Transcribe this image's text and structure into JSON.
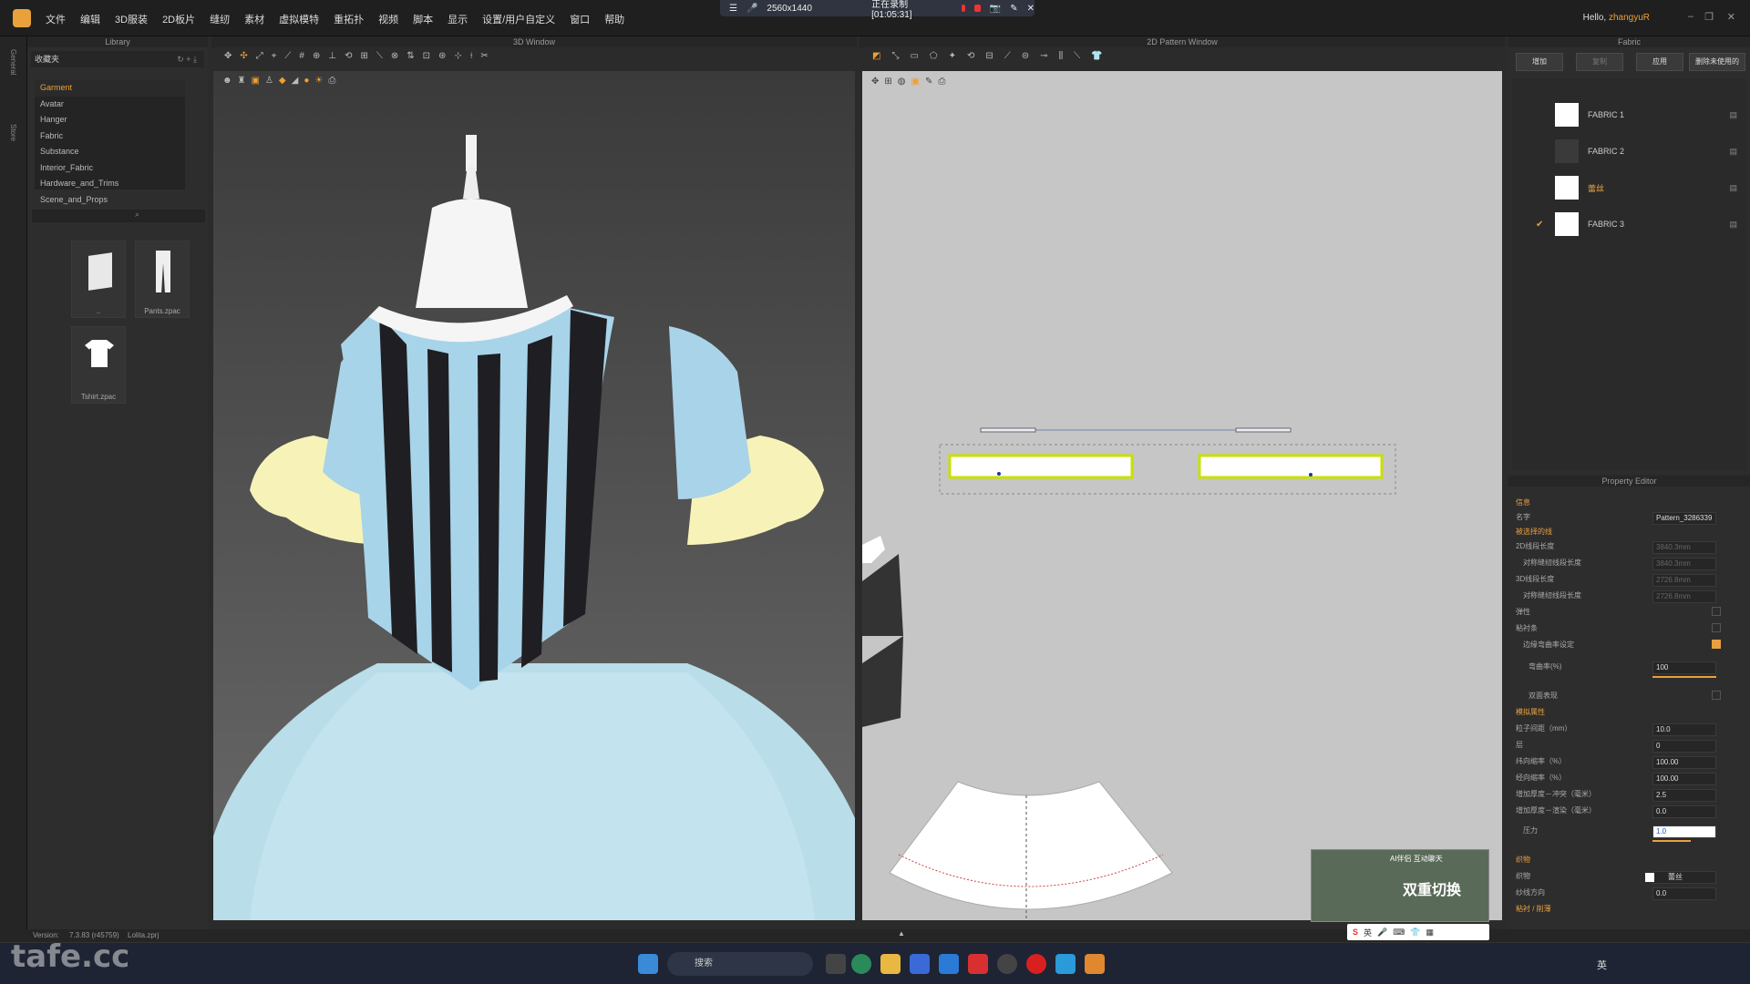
{
  "menubar": {
    "items": [
      "文件",
      "编辑",
      "3D服装",
      "2D板片",
      "缝纫",
      "素材",
      "虚拟模特",
      "重拓扑",
      "视频",
      "脚本",
      "显示",
      "设置/用户自定义",
      "窗口",
      "帮助"
    ],
    "greeting": "Hello,",
    "user": "zhangyuR"
  },
  "recording": {
    "resolution": "2560x1440",
    "status": "正在录制 [01:05:31]"
  },
  "leftstrip": {
    "tabs": [
      "General",
      "Store"
    ]
  },
  "library": {
    "title": "Library",
    "folder": "收藏夹",
    "tree": [
      "Garment",
      "Avatar",
      "Hanger",
      "Fabric",
      "Substance",
      "Interior_Fabric",
      "Hardware_and_Trims",
      "Scene_and_Props"
    ],
    "selected": 0,
    "thumbnails": [
      {
        "label": "..",
        "icon": "folder-icon"
      },
      {
        "label": "Pants.zpac",
        "icon": "pants-icon"
      },
      {
        "label": "Tshirt.zpac",
        "icon": "tshirt-icon"
      }
    ]
  },
  "view3d": {
    "title": "3D Window"
  },
  "view2d": {
    "title": "2D Pattern Window"
  },
  "fabric": {
    "title": "Fabric",
    "buttons": [
      "增加",
      "复制",
      "应用",
      "删除未使用的"
    ],
    "items": [
      {
        "name": "FABRIC 1",
        "color": "#ffffff",
        "checked": false
      },
      {
        "name": "FABRIC 2",
        "color": "#3a3a3a",
        "checked": false
      },
      {
        "name": "蕾丝",
        "color": "#ffffff",
        "checked": false,
        "highlight": true
      },
      {
        "name": "FABRIC 3",
        "color": "#ffffff",
        "checked": true
      }
    ]
  },
  "property": {
    "title": "Property Editor",
    "sections": {
      "info": "信息",
      "name_label": "名字",
      "name_value": "Pattern_3286339",
      "selected_line": "被选择的线",
      "len2d": "2D线段长度",
      "len2d_val": "3840.3mm",
      "len2d_sym": "对称缝纫线段长度",
      "len2d_sym_val": "3840.3mm",
      "len3d": "3D线段长度",
      "len3d_val": "2726.8mm",
      "len3d_sym": "对称缝纫线段长度",
      "len3d_sym_val": "2726.8mm",
      "elastic": "弹性",
      "sym": "粘衬条",
      "edge_shrink": "边缘弯曲率设定",
      "curve_rate": "弯曲率(%)",
      "curve_rate_val": "100",
      "fold": "双面表现",
      "sim_props": "模拟属性",
      "particle": "粒子间距（mm）",
      "particle_val": "10.0",
      "layer": "层",
      "layer_val": "0",
      "shrink_w": "纬向缩率（%）",
      "shrink_w_val": "100.00",
      "shrink_h": "经向缩率（%）",
      "shrink_h_val": "100.00",
      "add_thick_render": "增加厚度－冲突（毫米）",
      "add_thick_render_val": "2.5",
      "add_thick_coll": "增加厚度－渲染（毫米）",
      "add_thick_coll_val": "0.0",
      "pressure": "压力",
      "pressure_val": "1.0",
      "fabric_sec": "织物",
      "fabric_label": "织物",
      "fabric_val": "蕾丝",
      "grain": "纱线方向",
      "grain_val": "0.0",
      "trim": "粘衬 / 削薄"
    }
  },
  "status": {
    "version_label": "Version:",
    "version": "7.3.83 (r45759)",
    "file": "Lolita.zprj"
  },
  "taskbar": {
    "search": "搜索",
    "lang": "英"
  },
  "watermark": "tafe.cc",
  "ad": {
    "line1": "AI伴侣 互动聊天",
    "line2": "双重切换"
  },
  "ime": {
    "label": "英"
  }
}
